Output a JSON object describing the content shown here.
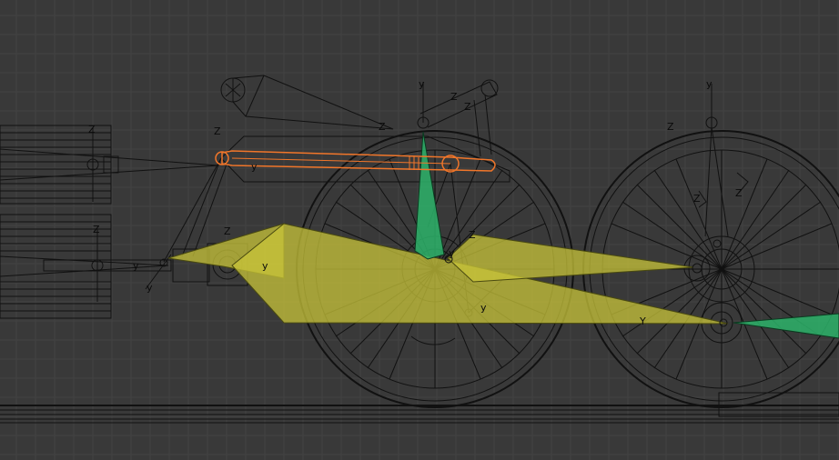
{
  "viewport": {
    "title": "",
    "background_color": "#393939",
    "grid_color": "#434343",
    "wire_color": "#111111",
    "selected_color": "#f1762a",
    "bone_yellow_color": "#c8c43a",
    "bone_green_color": "#2db36a"
  },
  "axis_labels": {
    "z1": "Z",
    "z2": "Z",
    "z3": "Z",
    "z4": "Z",
    "z5": "Z",
    "z6": "Z",
    "z7": "Z",
    "z8": "Z",
    "z9": "Z",
    "z10": "Z",
    "z11": "Z",
    "y1": "y",
    "y2": "y",
    "y3": "y",
    "y4": "y",
    "y5": "y",
    "y6": "y",
    "y7": "Y",
    "y8": "y",
    "y9": "y"
  },
  "icons": {
    "selected_bone": "orange-outline-bone",
    "armature": "locomotive-valve-gear-armature"
  }
}
